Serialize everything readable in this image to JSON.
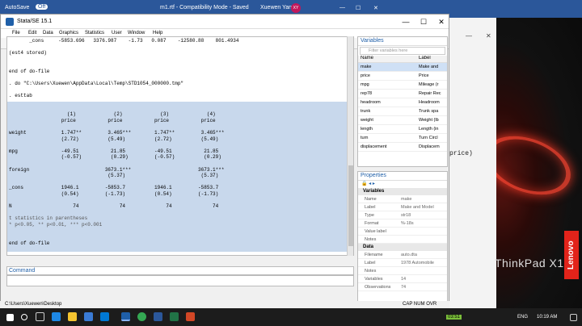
{
  "word": {
    "autosave": "AutoSave",
    "off": "Off",
    "doc_title": "m1.rtf  -  Compatibility Mode  -  Saved",
    "user": "Xuewen Yan",
    "avatar_initials": "XY",
    "fragment": "price)"
  },
  "laptop": {
    "brand": "ThinkPad X1",
    "vendor": "Lenovo"
  },
  "stata": {
    "title": "Stata/SE 15.1",
    "menu": [
      "File",
      "Edit",
      "Data",
      "Graphics",
      "Statistics",
      "User",
      "Window",
      "Help"
    ],
    "results_lines": [
      "       _cons     -5853.696   3376.987    -1.73   0.087    -12580.88    801.4934",
      "",
      "(est4 stored)",
      "",
      "",
      "end of do-file",
      "",
      ". do \"C:\\Users\\Xuewen\\AppData\\Local\\Temp\\STD1054_000000.tmp\"",
      "",
      ". esttab",
      "",
      "",
      "                    (1)             (2)             (3)             (4)",
      "                  price           price           price           price",
      "",
      "weight            1.747**         3.465***        1.747**         3.465***",
      "                  (2.72)          (5.49)          (2.72)          (5.49)",
      "",
      "mpg               -49.51           21.85          -49.51           21.85",
      "                  (-0.57)          (0.29)         (-0.57)          (0.29)",
      "",
      "foreign                          3673.1***                       3673.1***",
      "                                  (5.37)                          (5.37)",
      "",
      "_cons             1946.1         -5853.7          1946.1         -5853.7",
      "                  (0.54)         (-1.73)          (0.54)         (-1.73)",
      "",
      "N                     74              74              74              74",
      "",
      "t statistics in parentheses",
      "* p<0.05, ** p<0.01, *** p<0.001",
      "",
      "",
      "end of do-file",
      "",
      "."
    ],
    "command_label": "Command",
    "status_path": "C:\\Users\\Xuewen\\Desktop",
    "status_flags": "CAP   NUM   OVR"
  },
  "variables": {
    "title": "Variables",
    "filter_placeholder": "Filter variables here",
    "col_name": "Name",
    "col_label": "Label",
    "rows": [
      {
        "name": "make",
        "label": "Make and"
      },
      {
        "name": "price",
        "label": "Price"
      },
      {
        "name": "mpg",
        "label": "Mileage (r"
      },
      {
        "name": "rep78",
        "label": "Repair Rec"
      },
      {
        "name": "headroom",
        "label": "Headroom"
      },
      {
        "name": "trunk",
        "label": "Trunk spa"
      },
      {
        "name": "weight",
        "label": "Weight (lb"
      },
      {
        "name": "length",
        "label": "Length (in"
      },
      {
        "name": "turn",
        "label": "Turn Circl"
      },
      {
        "name": "displacement",
        "label": "Displacem"
      }
    ]
  },
  "properties": {
    "title": "Properties",
    "sec_variables": "Variables",
    "var_rows": [
      {
        "k": "Name",
        "v": "make"
      },
      {
        "k": "Label",
        "v": "Make and Model"
      },
      {
        "k": "Type",
        "v": "str18"
      },
      {
        "k": "Format",
        "v": "%-18s"
      },
      {
        "k": "Value label",
        "v": ""
      },
      {
        "k": "Notes",
        "v": ""
      }
    ],
    "sec_data": "Data",
    "data_rows": [
      {
        "k": "Filename",
        "v": "auto.dta"
      },
      {
        "k": "Label",
        "v": "1978 Automobile"
      },
      {
        "k": "Notes",
        "v": ""
      },
      {
        "k": "Variables",
        "v": "14"
      },
      {
        "k": "Observations",
        "v": "74"
      }
    ]
  },
  "taskbar": {
    "time": "10:19 AM",
    "lang": "ENG",
    "vol_badge": "03:51"
  }
}
